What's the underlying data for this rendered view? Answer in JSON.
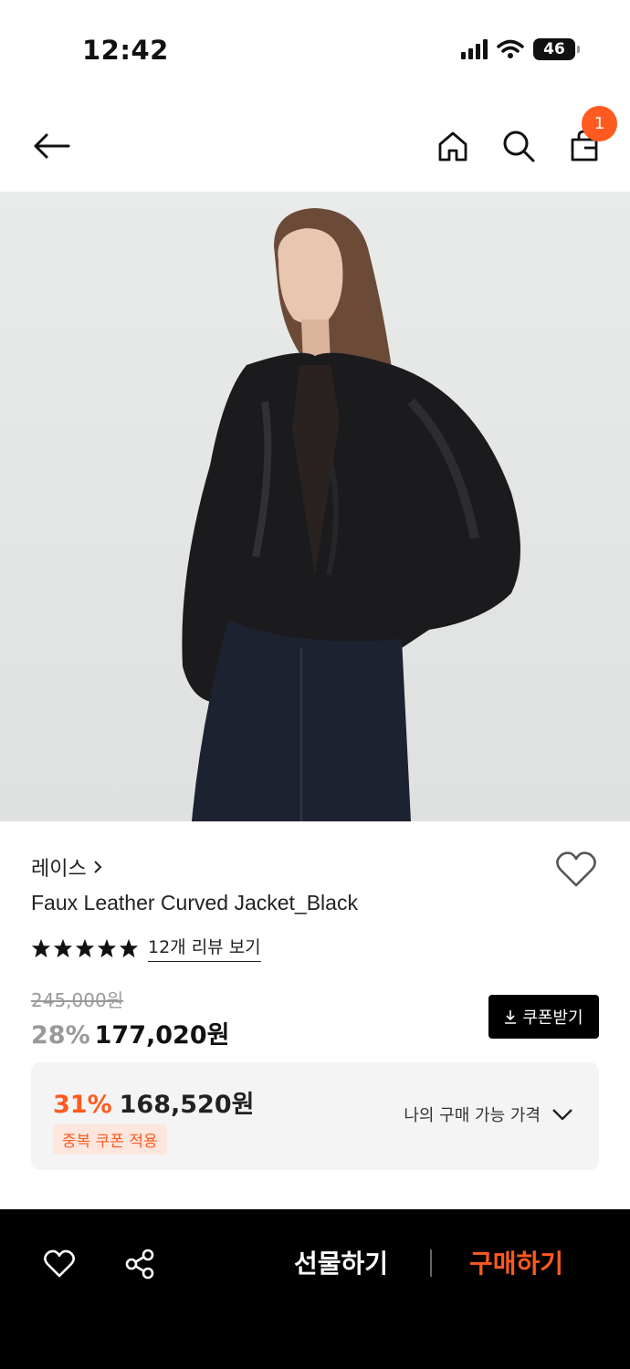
{
  "status_bar": {
    "time": "12:42",
    "battery": "46"
  },
  "header": {
    "cart_count": "1"
  },
  "product": {
    "brand": "레이스",
    "name": "Faux Leather Curved Jacket_Black",
    "rating_stars": 5,
    "review_link": "12개 리뷰 보기",
    "original_price": "245,000원",
    "discount_rate": "28%",
    "sale_price": "177,020원",
    "coupon_button": "쿠폰받기"
  },
  "my_price": {
    "discount_rate": "31%",
    "price": "168,520원",
    "badge": "중복 쿠폰 적용",
    "label": "나의 구매 가능 가격"
  },
  "bottom_bar": {
    "gift_label": "선물하기",
    "buy_label": "구매하기"
  },
  "colors": {
    "accent": "#ff5a1f",
    "dark": "#000000"
  }
}
